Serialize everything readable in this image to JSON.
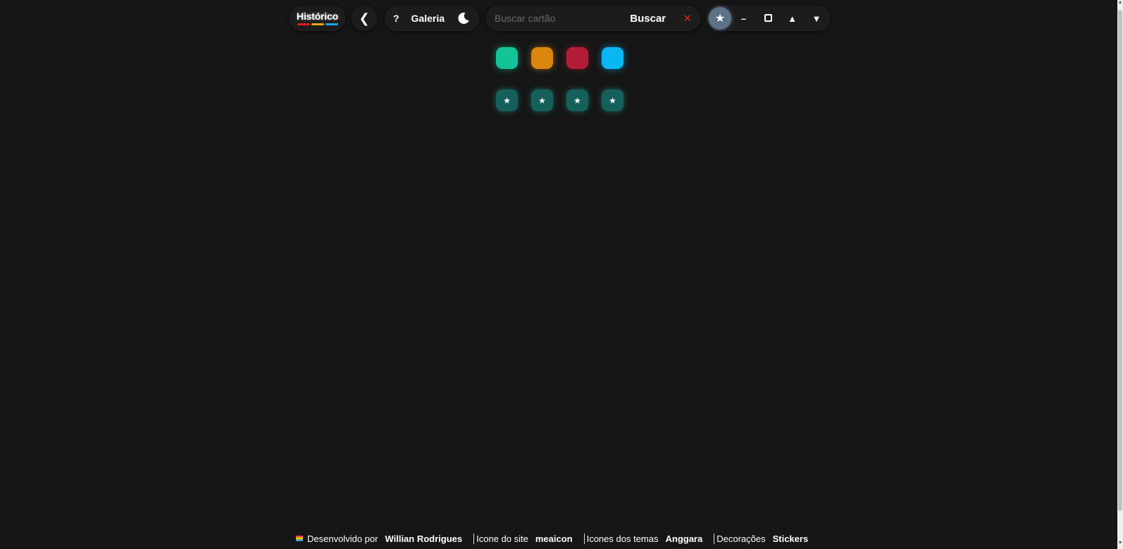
{
  "topbar": {
    "history_label": "Histórico",
    "history_bar_colors": [
      "#e01a1a",
      "#f2a516",
      "#1ea7e8"
    ],
    "back_icon": "chevron-left-icon",
    "back_glyph": "❮",
    "help_label": "?",
    "gallery_label": "Galeria",
    "theme_icon": "moon-icon",
    "search": {
      "placeholder": "Buscar cartão",
      "value": "",
      "button_label": "Buscar",
      "clear_glyph": "✕"
    },
    "window": {
      "favorite_glyph": "★",
      "minimize_glyph": "–",
      "up_glyph": "▲",
      "down_glyph": "▼"
    }
  },
  "swatches": [
    {
      "name": "green",
      "color": "#12c497",
      "glow": "rgba(18,196,151,0.55)"
    },
    {
      "name": "orange",
      "color": "#d9870f",
      "glow": "rgba(217,135,15,0.55)"
    },
    {
      "name": "red",
      "color": "#b41d37",
      "glow": "rgba(180,29,55,0.55)"
    },
    {
      "name": "blue",
      "color": "#0ab7f2",
      "glow": "rgba(10,183,242,0.6)"
    }
  ],
  "star_buttons": {
    "count_glyph": "★",
    "color": "#15605a"
  },
  "footer": {
    "developed_by": "Desenvolvido por",
    "developer": "Willian Rodrigues",
    "site_icon_label": "Icone do site",
    "site_icon_credit": "meaicon",
    "theme_icons_label": "Icones dos temas",
    "theme_icons_credit": "Anggara",
    "decorations_label": "Decorações",
    "decorations_credit": "Stickers"
  }
}
